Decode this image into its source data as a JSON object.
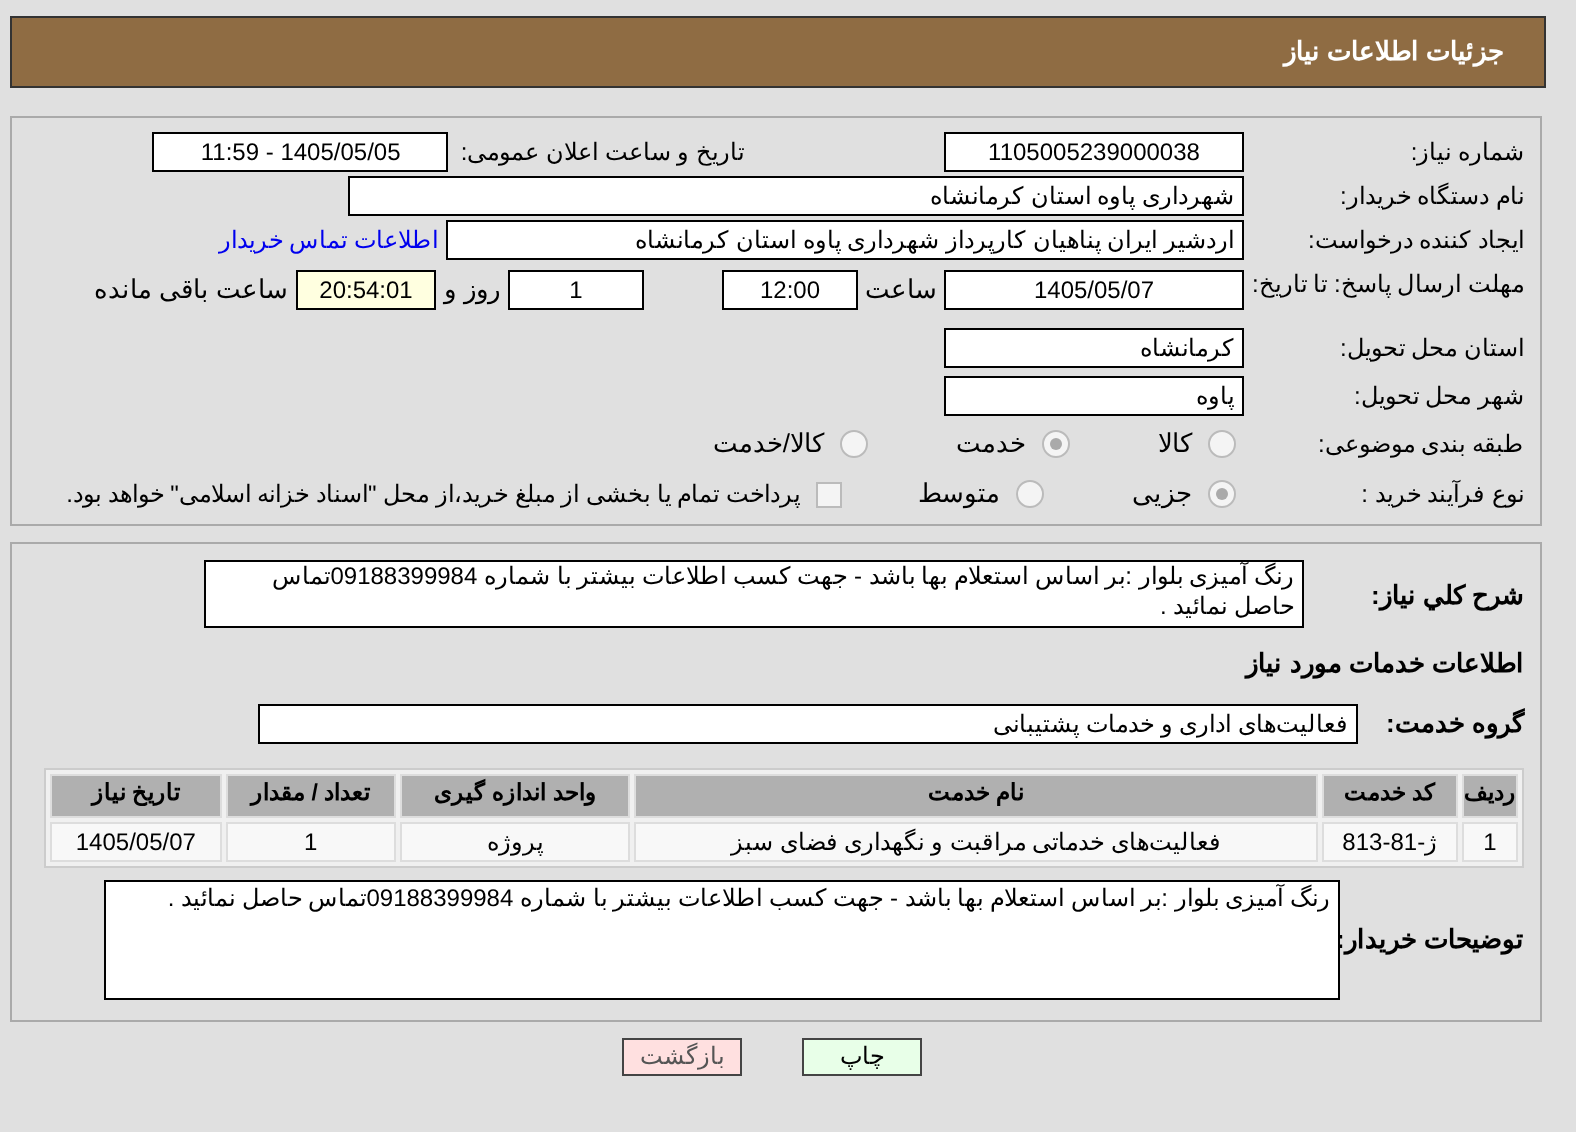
{
  "header": {
    "title": "جزئیات اطلاعات نیاز"
  },
  "need_number": {
    "label": "شماره نیاز:",
    "value": "1105005239000038"
  },
  "announce": {
    "label": "تاریخ و ساعت اعلان عمومی:",
    "value": "1405/05/05 - 11:59"
  },
  "buyer": {
    "label": "نام دستگاه خریدار:",
    "value": "شهرداری پاوه استان کرمانشاه"
  },
  "creator": {
    "label": "ایجاد کننده درخواست:",
    "value": "اردشیر ایران پناهیان کارپرداز شهرداری پاوه استان کرمانشاه",
    "link": "اطلاعات تماس خریدار"
  },
  "deadline": {
    "label": "مهلت ارسال پاسخ: تا تاریخ:",
    "date": "1405/05/07",
    "time_label": "ساعت",
    "time": "12:00",
    "days": "1",
    "days_label": "روز و",
    "remaining": "20:54:01",
    "remaining_label": "ساعت باقی مانده"
  },
  "province": {
    "label": "استان محل تحویل:",
    "value": "کرمانشاه"
  },
  "city": {
    "label": "شهر محل تحویل:",
    "value": "پاوه"
  },
  "category": {
    "label": "طبقه بندی موضوعی:",
    "options": [
      {
        "label": "کالا",
        "selected": false
      },
      {
        "label": "خدمت",
        "selected": true
      },
      {
        "label": "کالا/خدمت",
        "selected": false
      }
    ]
  },
  "process": {
    "label": "نوع فرآیند خرید :",
    "options": [
      {
        "label": "جزیی",
        "selected": true
      },
      {
        "label": "متوسط",
        "selected": false
      }
    ],
    "payment": {
      "checked": false,
      "label": "پرداخت تمام یا بخشی از مبلغ خرید،از محل \"اسناد خزانه اسلامی\" خواهد بود."
    }
  },
  "description": {
    "label": "شرح کلي نیاز:",
    "value": "رنگ آمیزی بلوار :بر اساس استعلام بها باشد - جهت کسب اطلاعات بیشتر با شماره 09188399984تماس حاصل نمائید ."
  },
  "services_title": "اطلاعات خدمات مورد نیاز",
  "service_group": {
    "label": "گروه خدمت:",
    "value": "فعالیت‌های اداری و خدمات پشتیبانی"
  },
  "table": {
    "columns": [
      "ردیف",
      "کد خدمت",
      "نام خدمت",
      "واحد اندازه گیری",
      "تعداد / مقدار",
      "تاریخ نیاز"
    ],
    "rows": [
      [
        "1",
        "ژ-81-813",
        "فعالیت‌های خدماتی مراقبت و نگهداری فضای سبز",
        "پروژه",
        "1",
        "1405/05/07"
      ]
    ]
  },
  "buyer_notes": {
    "label": "توضیحات خریدار:",
    "value": "رنگ آمیزی بلوار :بر اساس استعلام بها باشد - جهت کسب اطلاعات بیشتر با شماره 09188399984تماس حاصل نمائید ."
  },
  "buttons": [
    {
      "label": "چاپ",
      "kind": "print"
    },
    {
      "label": "بازگشت",
      "kind": "back"
    }
  ]
}
